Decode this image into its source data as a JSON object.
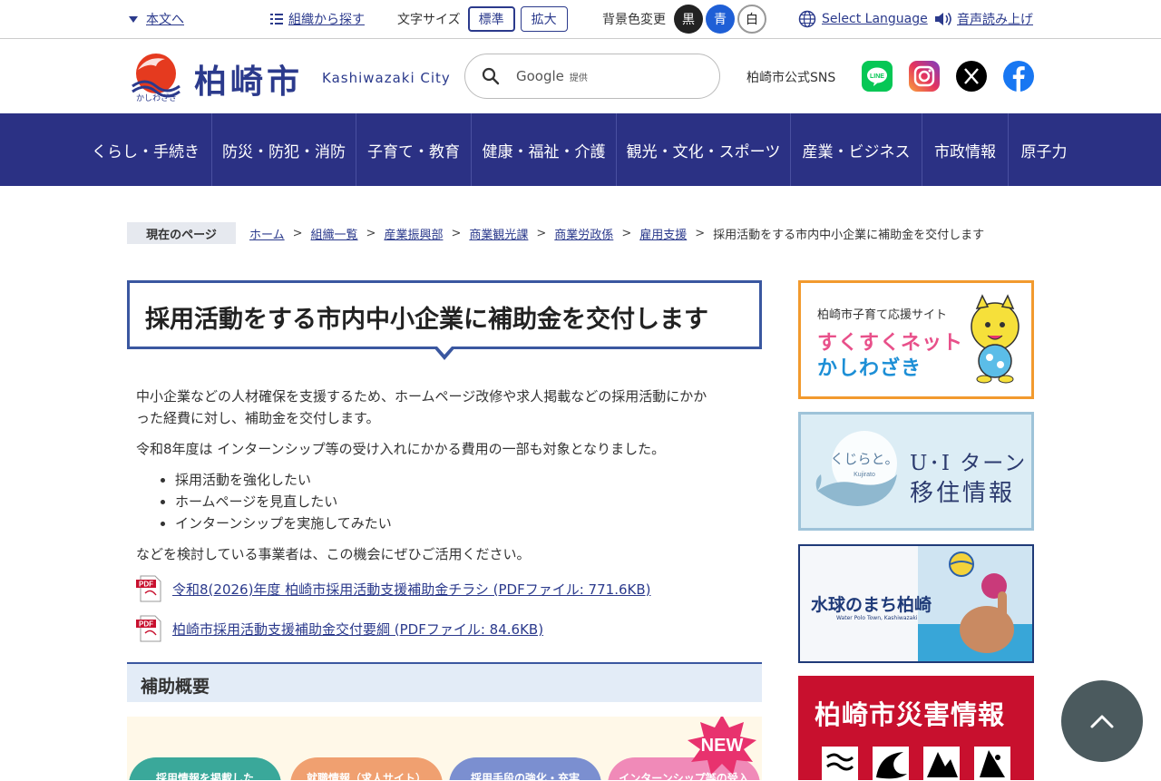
{
  "utility": {
    "skip_link": "本文へ",
    "org_link": "組織から探す",
    "font_size_label": "文字サイズ",
    "font_standard": "標準",
    "font_large": "拡大",
    "bg_label": "背景色変更",
    "bg_black": "黒",
    "bg_blue": "青",
    "bg_white": "白",
    "language": "Select Language",
    "voice": "音声読み上げ"
  },
  "header": {
    "logo_name": "柏崎市",
    "logo_en": "Kashiwazaki City",
    "logo_sub": "かしわざき",
    "search_brand": "Google",
    "search_brand_suffix": "提供",
    "sns_label": "柏崎市公式SNS",
    "sns_icons": [
      "line-icon",
      "instagram-icon",
      "x-icon",
      "facebook-icon"
    ]
  },
  "nav": {
    "items": [
      "くらし・手続き",
      "防災・防犯・消防",
      "子育て・教育",
      "健康・福祉・介護",
      "観光・文化・スポーツ",
      "産業・ビジネス",
      "市政情報",
      "原子力"
    ]
  },
  "breadcrumb": {
    "label": "現在のページ",
    "links": [
      "ホーム",
      "組織一覧",
      "産業振興部",
      "商業観光課",
      "商業労政係",
      "雇用支援"
    ],
    "current": "採用活動をする市内中小企業に補助金を交付します"
  },
  "main": {
    "title": "採用活動をする市内中小企業に補助金を交付します",
    "intro_line1": "中小企業などの人材確保を支援するため、ホームページ改修や求人掲載などの採用活動にかか",
    "intro_line2": "った経費に対し、補助金を交付します。",
    "note": "令和8年度は インターンシップ等の受け入れにかかる費用の一部も対象となりました。",
    "bullets": [
      "採用活動を強化したい",
      "ホームページを見直したい",
      "インターンシップを実施してみたい"
    ],
    "closing": "などを検討している事業者は、この機会にぜひご活用ください。",
    "pdf_links": [
      "令和8(2026)年度 柏崎市採用活動支援補助金チラシ (PDFファイル: 771.6KB)",
      "柏崎市採用活動支援補助金交付要綱 (PDFファイル: 84.6KB)"
    ],
    "section_title": "補助概要",
    "promo_new": "NEW",
    "promo_pills": [
      "採用情報を掲載した",
      "就職情報（求人サイト）",
      "採用手段の強化・充実",
      "インターンシップ等の受入"
    ]
  },
  "sidebar": {
    "banner1_top": "柏崎市子育て応援サイト",
    "banner1_line1": "すくすくネット",
    "banner1_line2": "かしわざき",
    "banner2_logo": "くじらと。",
    "banner2_logo_sub": "Kujirato",
    "banner2_line1": "U･I ターン",
    "banner2_line2": "移住情報",
    "banner3_title": "水球のまち柏崎",
    "banner3_sub": "Water Polo Town, Kashiwazaki",
    "banner4_title": "柏崎市災害情報"
  },
  "colors": {
    "nav_bg": "#2b3184",
    "accent": "#3a57a0",
    "link": "#2b3a8c",
    "disaster_red": "#c8102e"
  }
}
